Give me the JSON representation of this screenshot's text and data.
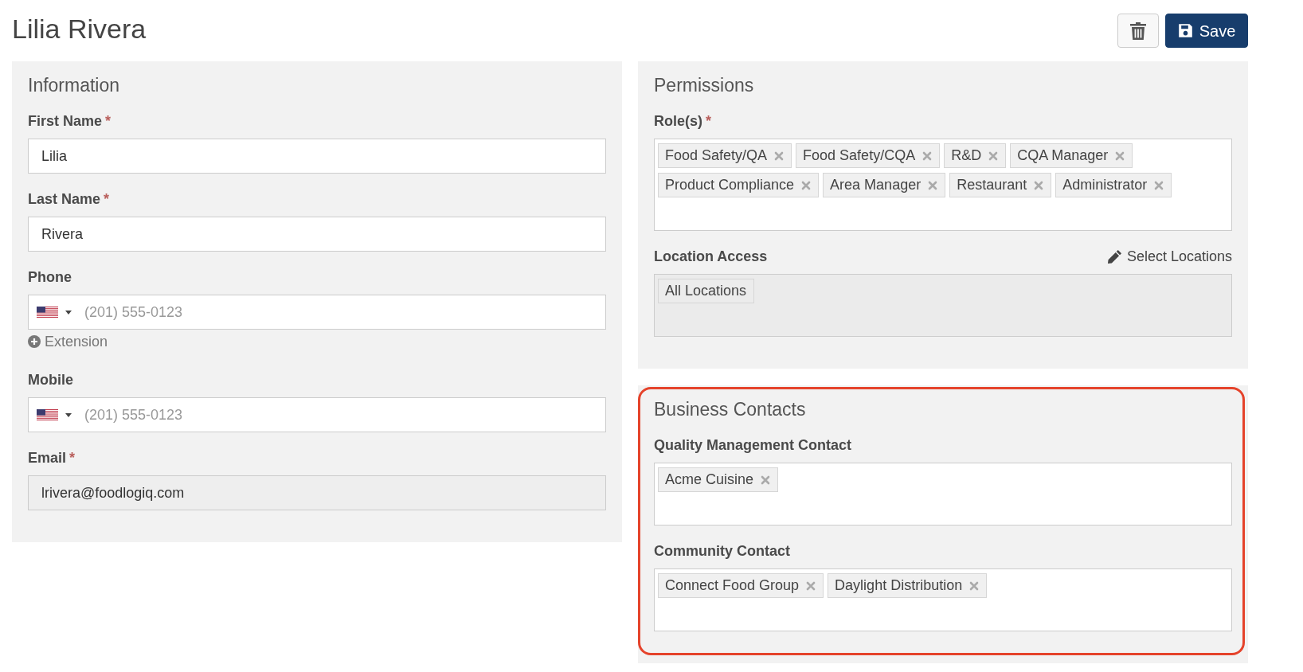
{
  "header": {
    "title": "Lilia Rivera",
    "actions": [
      {
        "kind": "delete"
      },
      {
        "kind": "save",
        "label": "Save"
      }
    ]
  },
  "information": {
    "title": "Information",
    "fields": [
      {
        "kind": "text",
        "label": "First Name",
        "required_mark": "*",
        "value": "Lilia",
        "disabled": false
      },
      {
        "kind": "text",
        "label": "Last Name",
        "required_mark": "*",
        "value": "Rivera",
        "disabled": false
      },
      {
        "kind": "phone",
        "label": "Phone",
        "placeholder": "(201) 555-0123",
        "extension": "Extension",
        "disabled": false
      },
      {
        "kind": "phone",
        "label": "Mobile",
        "placeholder": "(201) 555-0123",
        "disabled": false
      },
      {
        "kind": "text",
        "label": "Email",
        "required_mark": "*",
        "value": "lrivera@foodlogiq.com",
        "disabled": true
      }
    ]
  },
  "permissions": {
    "title": "Permissions",
    "fields": [
      {
        "kind": "tags",
        "label": "Role(s)",
        "required_mark": "*",
        "disabled": false,
        "tags": [
          {
            "label": "Food Safety/QA",
            "removable": true
          },
          {
            "label": "Food Safety/CQA",
            "removable": true
          },
          {
            "label": "R&D",
            "removable": true
          },
          {
            "label": "CQA Manager",
            "removable": true
          },
          {
            "label": "Product Compliance",
            "removable": true
          },
          {
            "label": "Area Manager",
            "removable": true
          },
          {
            "label": "Restaurant",
            "removable": true
          },
          {
            "label": "Administrator",
            "removable": true
          }
        ]
      },
      {
        "kind": "tags",
        "label": "Location Access",
        "action": "Select Locations",
        "disabled": true,
        "tags": [
          {
            "label": "All Locations",
            "removable": false
          }
        ]
      }
    ]
  },
  "business_contacts": {
    "title": "Business Contacts",
    "highlighted": true,
    "fields": [
      {
        "kind": "tags",
        "label": "Quality Management Contact",
        "disabled": false,
        "tags": [
          {
            "label": "Acme Cuisine",
            "removable": true
          }
        ]
      },
      {
        "kind": "tags",
        "label": "Community Contact",
        "disabled": false,
        "tags": [
          {
            "label": "Connect Food Group",
            "removable": true
          },
          {
            "label": "Daylight Distribution",
            "removable": true
          }
        ]
      }
    ]
  }
}
